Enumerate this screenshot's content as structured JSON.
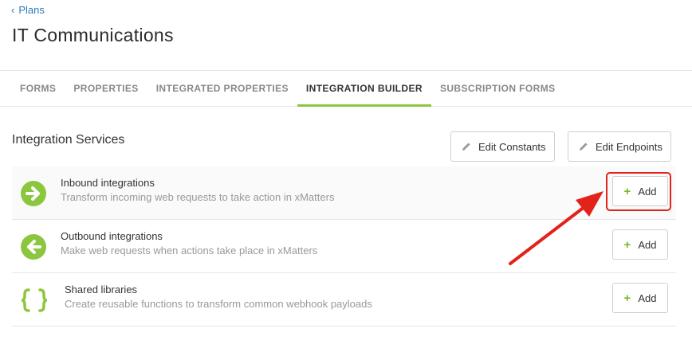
{
  "breadcrumb": {
    "chevron": "‹",
    "label": "Plans"
  },
  "page": {
    "title": "IT Communications"
  },
  "tabs": [
    {
      "label": "FORMS"
    },
    {
      "label": "PROPERTIES"
    },
    {
      "label": "INTEGRATED PROPERTIES"
    },
    {
      "label": "INTEGRATION BUILDER",
      "active": true
    },
    {
      "label": "SUBSCRIPTION FORMS"
    }
  ],
  "section": {
    "title": "Integration Services",
    "edit_constants_label": "Edit Constants",
    "edit_endpoints_label": "Edit Endpoints"
  },
  "services": [
    {
      "icon": "arrow-right-circle-icon",
      "title": "Inbound integrations",
      "description": "Transform incoming web requests to take action in xMatters",
      "add_label": "Add"
    },
    {
      "icon": "arrow-left-circle-icon",
      "title": "Outbound integrations",
      "description": "Make web requests when actions take place in xMatters",
      "add_label": "Add"
    },
    {
      "icon": "curly-braces-icon",
      "title": "Shared libraries",
      "description": "Create reusable functions to transform common webhook payloads",
      "add_label": "Add"
    }
  ],
  "colors": {
    "accent_green": "#8cc63f",
    "link_blue": "#2a7ab8",
    "annotation_red": "#e2231a"
  }
}
